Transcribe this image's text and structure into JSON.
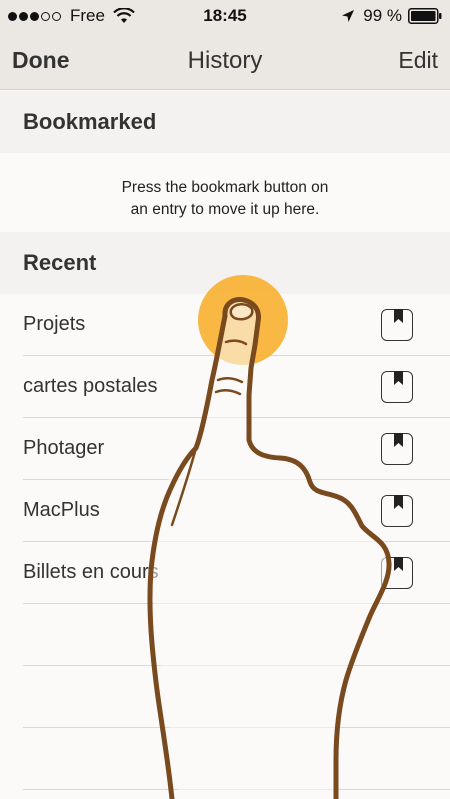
{
  "status_bar": {
    "carrier": "Free",
    "time": "18:45",
    "battery": "99 %",
    "signal_bars_filled": 3,
    "signal_bars_total": 5
  },
  "nav": {
    "left_label": "Done",
    "title": "History",
    "right_label": "Edit"
  },
  "bookmarked": {
    "header": "Bookmarked",
    "hint_line1": "Press the bookmark button on",
    "hint_line2": "an entry to move it up here."
  },
  "recent": {
    "header": "Recent",
    "items": [
      {
        "label": "Projets"
      },
      {
        "label": "cartes postales"
      },
      {
        "label": "Photager"
      },
      {
        "label": "MacPlus"
      },
      {
        "label": "Billets en cours"
      }
    ]
  },
  "icons": {
    "signal": "signal-dots-icon",
    "wifi": "wifi-icon",
    "location": "location-arrow-icon",
    "battery": "battery-icon",
    "bookmark": "bookmark-icon",
    "tap_hint": "tap-gesture-hand-icon"
  },
  "colors": {
    "bar_background": "#ebe8e3",
    "section_background": "#f3f2f0",
    "row_background": "#fbfaf8",
    "text": "#333333",
    "tap_circle": "#f9b233",
    "hand_outline": "#7a4a1f"
  }
}
